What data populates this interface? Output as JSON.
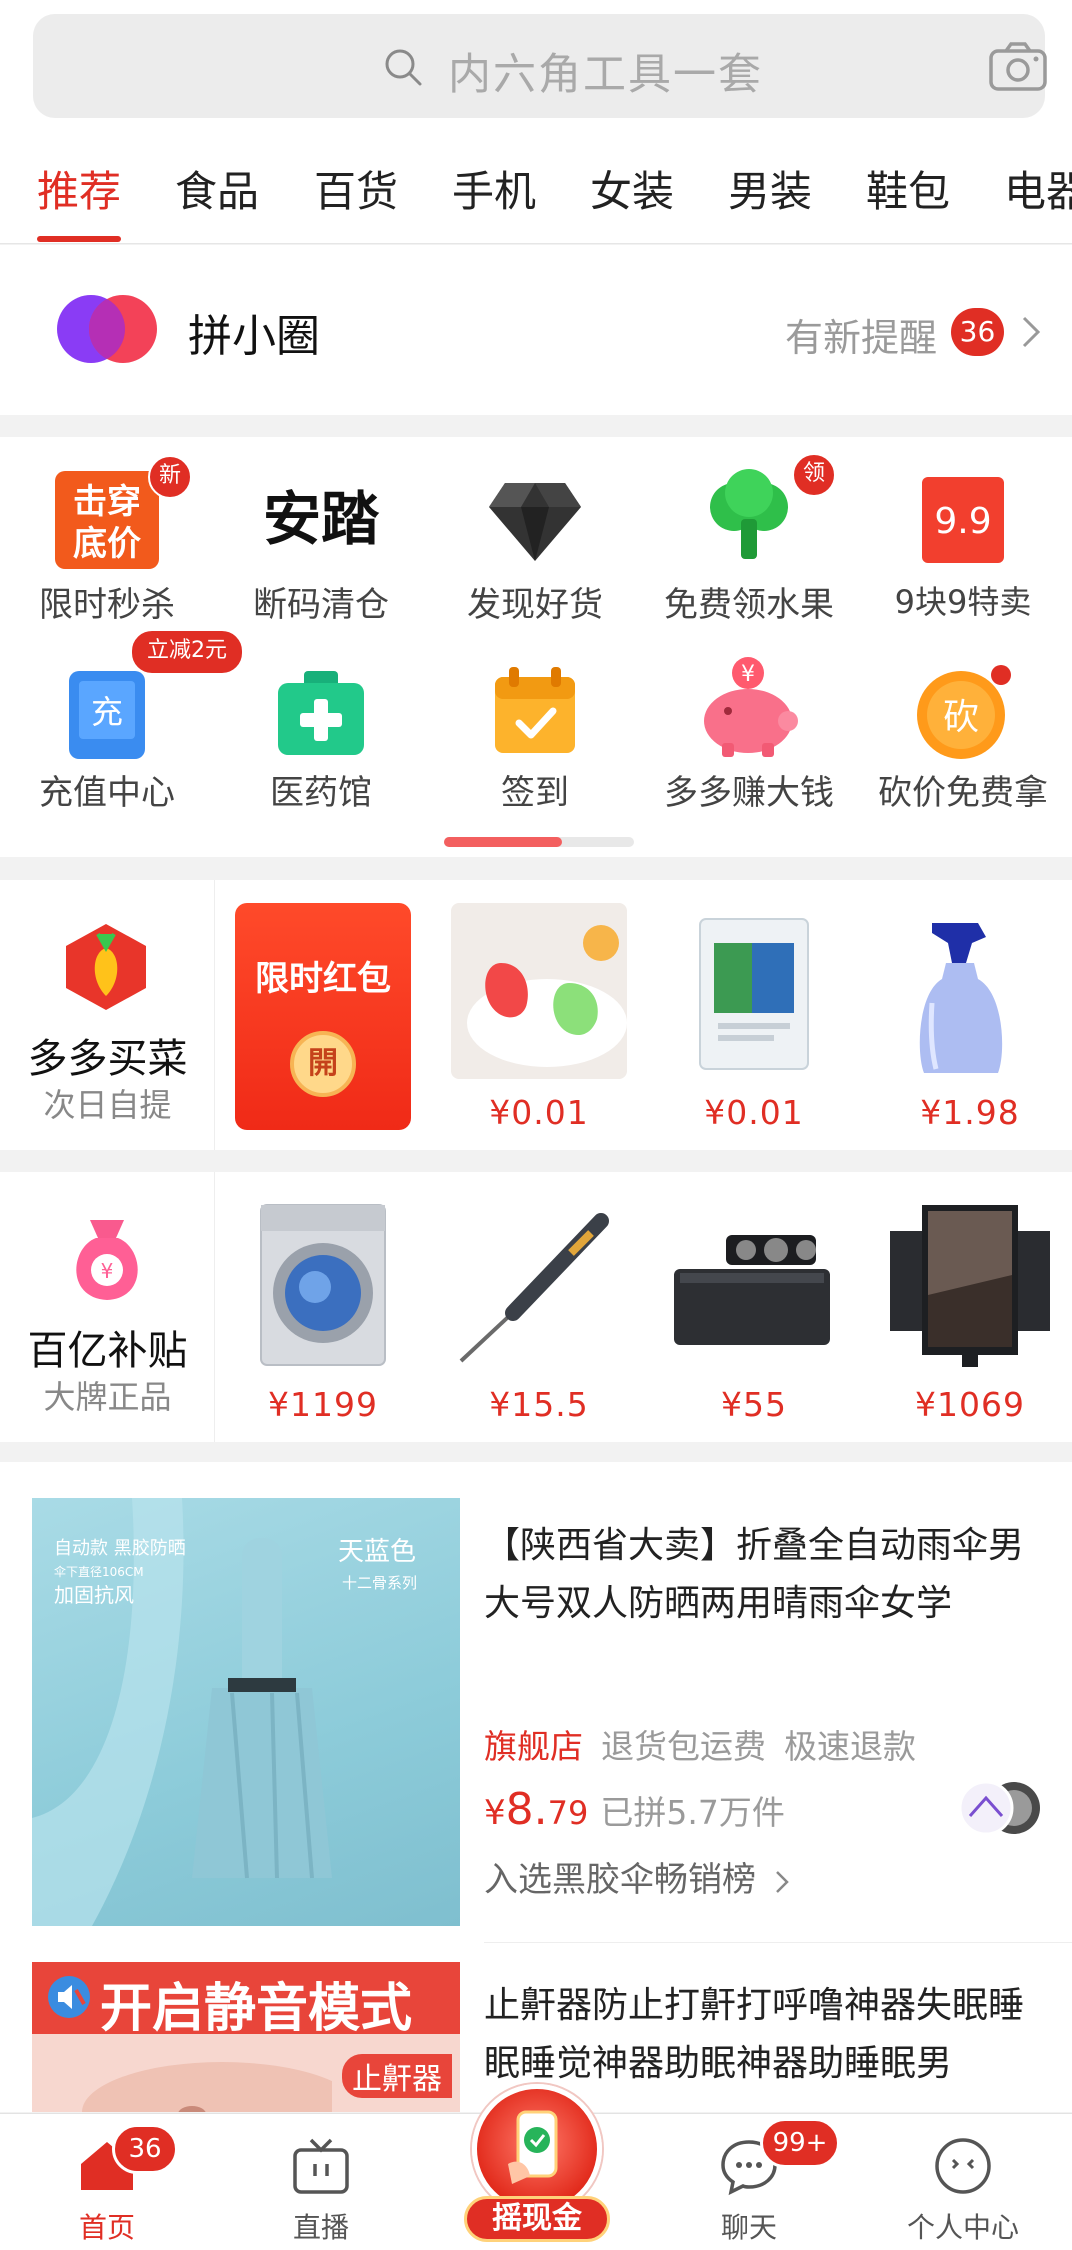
{
  "search": {
    "placeholder": "内六角工具一套"
  },
  "categories": [
    "推荐",
    "食品",
    "百货",
    "手机",
    "女装",
    "男装",
    "鞋包",
    "电器"
  ],
  "circle": {
    "title": "拼小圈",
    "remind": "有新提醒",
    "badge": "36"
  },
  "grid": [
    {
      "label": "限时秒杀",
      "icon": "flash-sale-icon",
      "badge": "新"
    },
    {
      "label": "断码清仓",
      "icon": "anta-logo",
      "logo_text": "安踏"
    },
    {
      "label": "发现好货",
      "icon": "diamond-icon"
    },
    {
      "label": "免费领水果",
      "icon": "tree-icon",
      "badge": "领"
    },
    {
      "label": "9块9特卖",
      "icon": "nine-nine-icon",
      "logo_text": "9.9"
    },
    {
      "label": "充值中心",
      "icon": "recharge-icon",
      "badge": "立减2元",
      "logo_text": "充"
    },
    {
      "label": "医药馆",
      "icon": "medicine-box-icon"
    },
    {
      "label": "签到",
      "icon": "calendar-check-icon"
    },
    {
      "label": "多多赚大钱",
      "icon": "piggy-bank-icon"
    },
    {
      "label": "砍价免费拿",
      "icon": "bargain-icon",
      "logo_text": "砍"
    }
  ],
  "grid_logo_texts": {
    "flash_sale_1": "击穿",
    "flash_sale_2": "底价",
    "coin": "¥"
  },
  "strip1": {
    "title": "多多买菜",
    "sub": "次日自提",
    "redpack": {
      "text": "限时红包",
      "coin": "開"
    },
    "products": [
      {
        "price": "¥0.01",
        "icon": "apple-peeler-image"
      },
      {
        "price": "¥0.01",
        "icon": "salt-bag-image"
      },
      {
        "price": "¥1.98",
        "icon": "spray-bottle-image"
      }
    ]
  },
  "strip2": {
    "title": "百亿补贴",
    "sub": "大牌正品",
    "products": [
      {
        "price": "¥1199",
        "icon": "washing-machine-image"
      },
      {
        "price": "¥15.5",
        "icon": "soldering-iron-image"
      },
      {
        "price": "¥55",
        "icon": "pipe-welder-image"
      },
      {
        "price": "¥1069",
        "icon": "monitor-image"
      }
    ]
  },
  "feed": [
    {
      "title": "【陕西省大卖】折叠全自动雨伞男大号双人防晒两用晴雨伞女学",
      "store": "旗舰店",
      "tags": [
        "退货包运费",
        "极速退款"
      ],
      "price_symbol": "¥",
      "price_int": "8.",
      "price_dec": "79",
      "sold": "已拼5.7万件",
      "rank": "入选黑胶伞畅销榜",
      "image_text": {
        "line1": "自动款 黑胶防晒",
        "line2": "伞下直径106CM",
        "line3": "加固抗风",
        "color": "天蓝色",
        "series": "十二骨系列"
      }
    },
    {
      "title": "止鼾器防止打鼾打呼噜神器失眠睡眠睡觉神器助眠神器助睡眠男",
      "image_text": {
        "banner": "开启静音模式",
        "chip": "止鼾器"
      }
    }
  ],
  "nav": [
    {
      "label": "首页",
      "icon": "home-icon",
      "badge": "36",
      "active": true
    },
    {
      "label": "直播",
      "icon": "tv-icon"
    },
    {
      "label": "摇现金",
      "icon": "shake-cash-icon"
    },
    {
      "label": "聊天",
      "icon": "chat-icon",
      "badge": "99+"
    },
    {
      "label": "个人中心",
      "icon": "profile-icon"
    }
  ],
  "colors": {
    "accent": "#e02e24",
    "text": "#222222",
    "muted": "#9a9a9a"
  }
}
